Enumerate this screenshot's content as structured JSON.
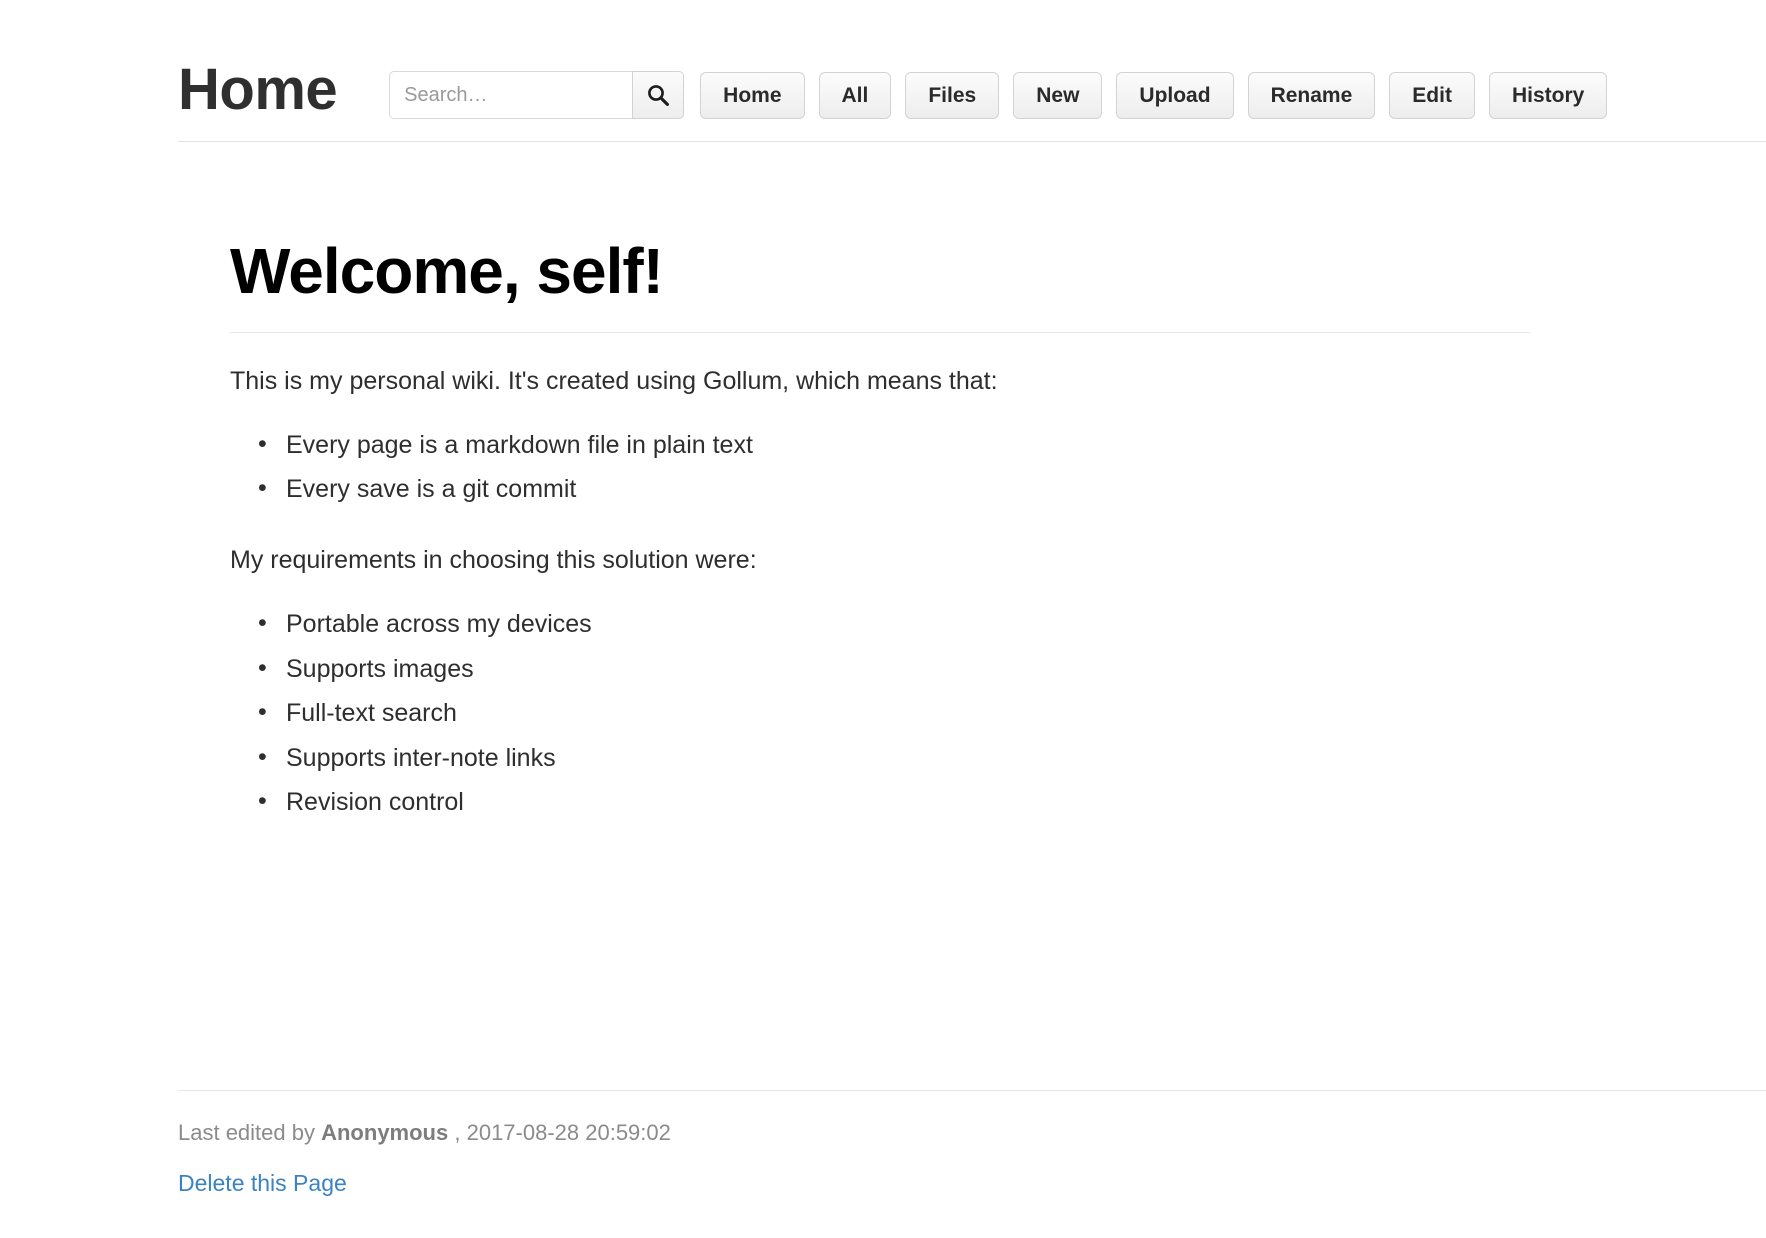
{
  "header": {
    "site_title": "Home",
    "search": {
      "placeholder": "Search…",
      "value": "",
      "icon": "search-icon",
      "button_label": ""
    },
    "nav_buttons": [
      {
        "label": "Home"
      },
      {
        "label": "All"
      },
      {
        "label": "Files"
      },
      {
        "label": "New"
      },
      {
        "label": "Upload"
      },
      {
        "label": "Rename"
      },
      {
        "label": "Edit"
      },
      {
        "label": "History"
      }
    ]
  },
  "main": {
    "heading": "Welcome, self!",
    "intro_paragraph": "This is my personal wiki. It's created using Gollum, which means that:",
    "first_list": [
      "Every page is a markdown file in plain text",
      "Every save is a git commit"
    ],
    "second_paragraph": "My requirements in choosing this solution were:",
    "second_list": [
      "Portable across my devices",
      "Supports images",
      "Full-text search",
      "Supports inter-note links",
      "Revision control"
    ]
  },
  "footer": {
    "last_edited_prefix": "Last edited by ",
    "author": "Anonymous",
    "timestamp_separator": ", ",
    "timestamp": "2017-08-28 20:59:02",
    "delete_link_label": "Delete this Page"
  },
  "colors": {
    "link": "#3b82c4",
    "text": "#2e2e2e",
    "muted": "#8b8b8b",
    "button_face": "#ededed",
    "border": "#d3d3d3"
  }
}
